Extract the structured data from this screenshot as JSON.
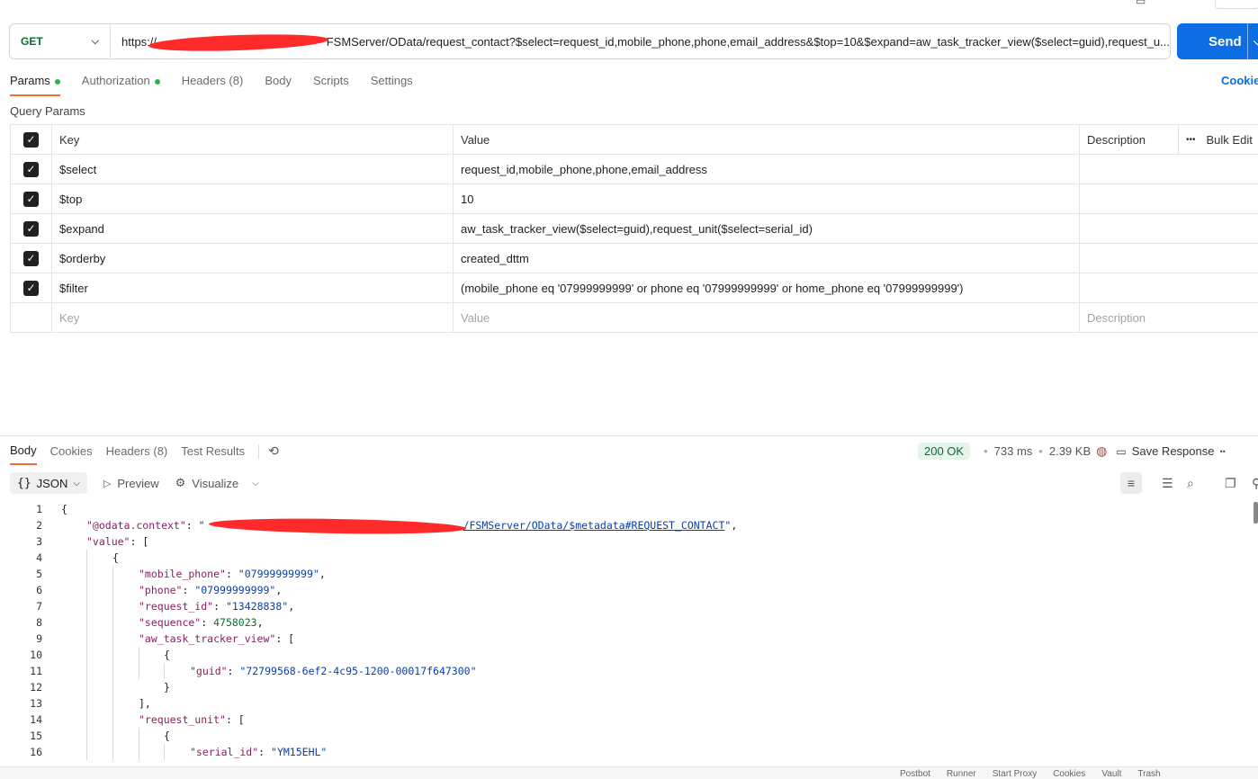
{
  "request": {
    "method": "GET",
    "url_prefix": "https://",
    "url_visible": "FSMServer/OData/request_contact?$select=request_id,mobile_phone,phone,email_address&$top=10&$expand=aw_task_tracker_view($select=guid),request_u...",
    "send_label": "Send",
    "redaction_color": "#ff2a2a"
  },
  "request_tabs": [
    {
      "label": "Params",
      "dot": true
    },
    {
      "label": "Authorization",
      "dot": true
    },
    {
      "label": "Headers (8)"
    },
    {
      "label": "Body"
    },
    {
      "label": "Scripts"
    },
    {
      "label": "Settings"
    }
  ],
  "cookies_link": "Cookie",
  "query_params": {
    "title": "Query Params",
    "headers": {
      "key": "Key",
      "value": "Value",
      "description": "Description",
      "bulk_edit": "Bulk Edit"
    },
    "rows": [
      {
        "key": "$select",
        "value": "request_id,mobile_phone,phone,email_address",
        "checked": true
      },
      {
        "key": "$top",
        "value": "10",
        "checked": true
      },
      {
        "key": "$expand",
        "value": "aw_task_tracker_view($select=guid),request_unit($select=serial_id)",
        "checked": true
      },
      {
        "key": "$orderby",
        "value": "created_dttm",
        "checked": true
      },
      {
        "key": "$filter",
        "value": "(mobile_phone eq '07999999999' or phone eq '07999999999'  or home_phone eq '07999999999')",
        "checked": true
      }
    ],
    "placeholder": {
      "key": "Key",
      "value": "Value",
      "description": "Description"
    }
  },
  "response": {
    "tabs": [
      "Body",
      "Cookies",
      "Headers (8)",
      "Test Results"
    ],
    "status": "200 OK",
    "time": "733 ms",
    "size": "2.39 KB",
    "save_label": "Save Response",
    "format": "JSON",
    "preview": "Preview",
    "visualize": "Visualize",
    "body_lines": [
      "{",
      "\"@odata.context\": \"/FSMServer/OData/$metadata#REQUEST_CONTACT\",",
      "\"value\": [",
      "{",
      "\"mobile_phone\": \"07999999999\",",
      "\"phone\": \"07999999999\",",
      "\"request_id\": \"13428838\",",
      "\"sequence\": 4758023,",
      "\"aw_task_tracker_view\": [",
      "{",
      "\"guid\": \"72799568-6ef2-4c95-1200-00017f647300\"",
      "}",
      "],",
      "\"request_unit\": [",
      "{",
      "\"serial_id\": \"YM15EHL\""
    ]
  },
  "footer": [
    "Postbot",
    "Runner",
    "Start Proxy",
    "Cookies",
    "Vault",
    "Trash"
  ]
}
